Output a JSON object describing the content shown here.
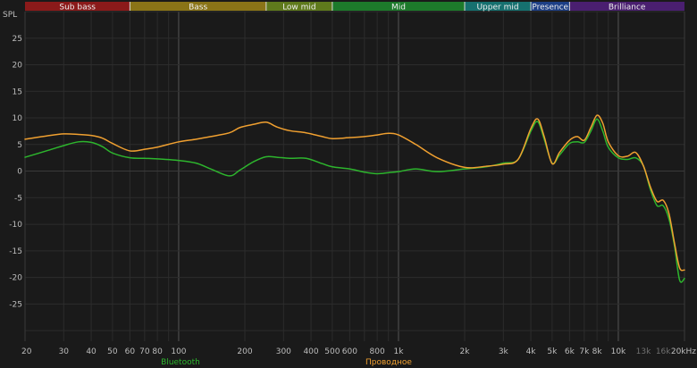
{
  "chart_data": {
    "type": "line",
    "title": "",
    "ylabel": "SPL",
    "xlabel": "",
    "x_scale": "log",
    "xlim": [
      20,
      20000
    ],
    "ylim": [
      -30,
      30
    ],
    "grid": true,
    "x_ticks": [
      {
        "v": 20,
        "label": "20"
      },
      {
        "v": 30,
        "label": "30"
      },
      {
        "v": 40,
        "label": "40"
      },
      {
        "v": 50,
        "label": "50"
      },
      {
        "v": 60,
        "label": "60"
      },
      {
        "v": 70,
        "label": "70"
      },
      {
        "v": 80,
        "label": "80"
      },
      {
        "v": 100,
        "label": "100"
      },
      {
        "v": 200,
        "label": "200"
      },
      {
        "v": 300,
        "label": "300"
      },
      {
        "v": 400,
        "label": "400"
      },
      {
        "v": 500,
        "label": "500"
      },
      {
        "v": 600,
        "label": "600"
      },
      {
        "v": 800,
        "label": "800"
      },
      {
        "v": 1000,
        "label": "1k"
      },
      {
        "v": 2000,
        "label": "2k"
      },
      {
        "v": 3000,
        "label": "3k"
      },
      {
        "v": 4000,
        "label": "4k"
      },
      {
        "v": 5000,
        "label": "5k"
      },
      {
        "v": 6000,
        "label": "6k"
      },
      {
        "v": 7000,
        "label": "7k"
      },
      {
        "v": 8000,
        "label": "8k"
      },
      {
        "v": 10000,
        "label": "10k"
      },
      {
        "v": 13000,
        "label": "13k",
        "dim": true
      },
      {
        "v": 16000,
        "label": "16k",
        "dim": true
      },
      {
        "v": 20000,
        "label": "20kHz"
      }
    ],
    "y_ticks": [
      25,
      20,
      15,
      10,
      5,
      0,
      -5,
      -10,
      -15,
      -20,
      -25
    ],
    "bands": [
      {
        "name": "Sub bass",
        "from": 20,
        "to": 60,
        "color": "#8b1a1a"
      },
      {
        "name": "Bass",
        "from": 60,
        "to": 250,
        "color": "#8a7417"
      },
      {
        "name": "Low mid",
        "from": 250,
        "to": 500,
        "color": "#5f7a1c"
      },
      {
        "name": "Mid",
        "from": 500,
        "to": 2000,
        "color": "#1d7a2b"
      },
      {
        "name": "Upper mid",
        "from": 2000,
        "to": 4000,
        "color": "#16706f"
      },
      {
        "name": "Presence",
        "from": 4000,
        "to": 6000,
        "color": "#1d3f86"
      },
      {
        "name": "Brilliance",
        "from": 6000,
        "to": 20000,
        "color": "#4a1f70"
      }
    ],
    "series": [
      {
        "name": "Bluetooth",
        "color": "#2db52d",
        "x": [
          20,
          25,
          30,
          35,
          40,
          45,
          50,
          60,
          70,
          80,
          100,
          120,
          140,
          170,
          190,
          220,
          250,
          280,
          320,
          380,
          450,
          500,
          600,
          700,
          800,
          900,
          1000,
          1200,
          1500,
          2000,
          2500,
          3000,
          3500,
          4000,
          4300,
          4600,
          5000,
          5400,
          6000,
          6500,
          7000,
          7500,
          8000,
          8500,
          9000,
          10000,
          11000,
          12000,
          13000,
          14000,
          15000,
          16000,
          17000,
          18000,
          19000,
          20000
        ],
        "y": [
          2.6,
          3.8,
          4.8,
          5.5,
          5.4,
          4.6,
          3.4,
          2.5,
          2.4,
          2.3,
          2.0,
          1.5,
          0.4,
          -0.9,
          0.2,
          1.8,
          2.7,
          2.6,
          2.4,
          2.4,
          1.4,
          0.8,
          0.4,
          -0.2,
          -0.5,
          -0.3,
          -0.1,
          0.4,
          -0.1,
          0.4,
          0.8,
          1.5,
          2.2,
          7.5,
          9.3,
          6.0,
          1.5,
          3.0,
          5.2,
          5.5,
          5.4,
          7.5,
          9.8,
          7.5,
          4.5,
          2.5,
          2.2,
          2.5,
          1.0,
          -3.5,
          -6.5,
          -6.5,
          -9.0,
          -14.0,
          -20.5,
          -20.2
        ]
      },
      {
        "name": "Проводное",
        "color": "#f0a030",
        "x": [
          20,
          25,
          30,
          35,
          40,
          45,
          50,
          60,
          70,
          80,
          100,
          120,
          140,
          170,
          190,
          220,
          250,
          280,
          320,
          380,
          450,
          500,
          600,
          700,
          800,
          900,
          1000,
          1200,
          1500,
          2000,
          2500,
          3000,
          3500,
          4000,
          4300,
          4600,
          5000,
          5400,
          6000,
          6500,
          7000,
          7500,
          8000,
          8500,
          9000,
          10000,
          11000,
          12000,
          13000,
          14000,
          15000,
          16000,
          17000,
          18000,
          19000,
          20000
        ],
        "y": [
          6.0,
          6.6,
          7.0,
          6.9,
          6.7,
          6.2,
          5.2,
          3.8,
          4.1,
          4.5,
          5.5,
          6.0,
          6.5,
          7.2,
          8.2,
          8.8,
          9.2,
          8.3,
          7.6,
          7.2,
          6.5,
          6.1,
          6.3,
          6.5,
          6.8,
          7.1,
          6.8,
          5.0,
          2.5,
          0.7,
          0.9,
          1.3,
          2.2,
          8.0,
          9.8,
          6.5,
          1.4,
          3.5,
          5.8,
          6.5,
          5.8,
          8.2,
          10.5,
          9.0,
          5.5,
          2.9,
          2.8,
          3.5,
          1.0,
          -3.0,
          -5.7,
          -5.5,
          -8.0,
          -13.5,
          -18.2,
          -18.6
        ]
      }
    ]
  }
}
